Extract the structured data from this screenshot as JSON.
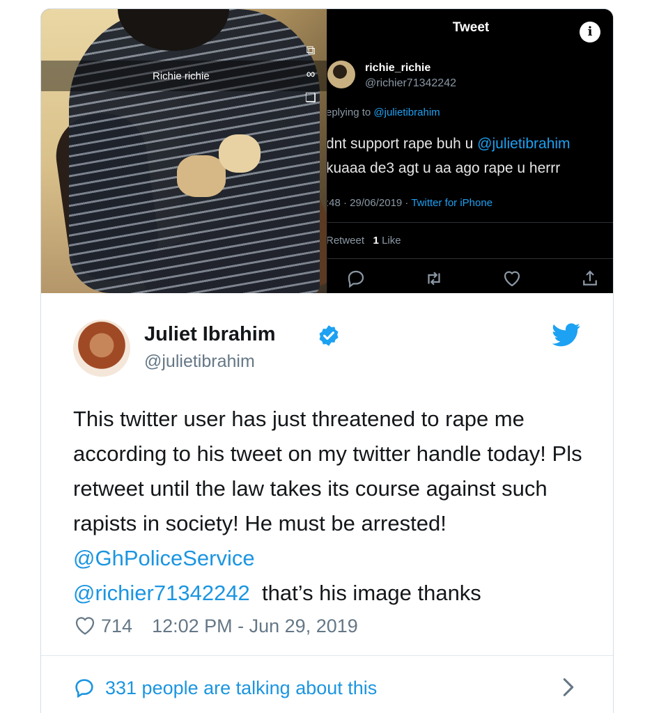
{
  "embedded_screenshot": {
    "left_photo": {
      "caption": "Richie richie"
    },
    "tweet_screen": {
      "title": "Tweet",
      "author_name": "richie_richie",
      "author_handle": "@richier71342242",
      "replying_prefix": "eplying to ",
      "replying_handle": "@julietibrahim",
      "text_line1_prefix": "dnt support rape buh u ",
      "text_line1_handle": "@julietibrahim",
      "text_line2": "kuaaa de3 agt u aa ago rape u herrr",
      "time_date": ":48 · 29/06/2019 · ",
      "source": "Twitter for iPhone",
      "retweet_label": "Retweet",
      "like_count": "1",
      "like_label": "Like",
      "icons": [
        "reply-icon",
        "retweet-icon",
        "like-icon",
        "share-icon"
      ]
    }
  },
  "tweet": {
    "author_name": "Juliet Ibrahim",
    "author_handle": "@julietibrahim",
    "text_part1": "This twitter user has just threatened to rape me according to his tweet on my twitter handle today! Pls retweet until the law takes its course against such rapists in society! He must be arrested! ",
    "mention1": "@GhPoliceService",
    "mention2": "@richier71342242",
    "text_part2": "  that’s his image thanks",
    "like_count": "714",
    "timestamp": "12:02 PM - Jun 29, 2019",
    "talking_about": "331 people are talking about this"
  },
  "colors": {
    "link_blue": "#1b95e0",
    "twitter_blue": "#1da1f2",
    "muted_gray": "#657786",
    "text_dark": "#14171a"
  }
}
